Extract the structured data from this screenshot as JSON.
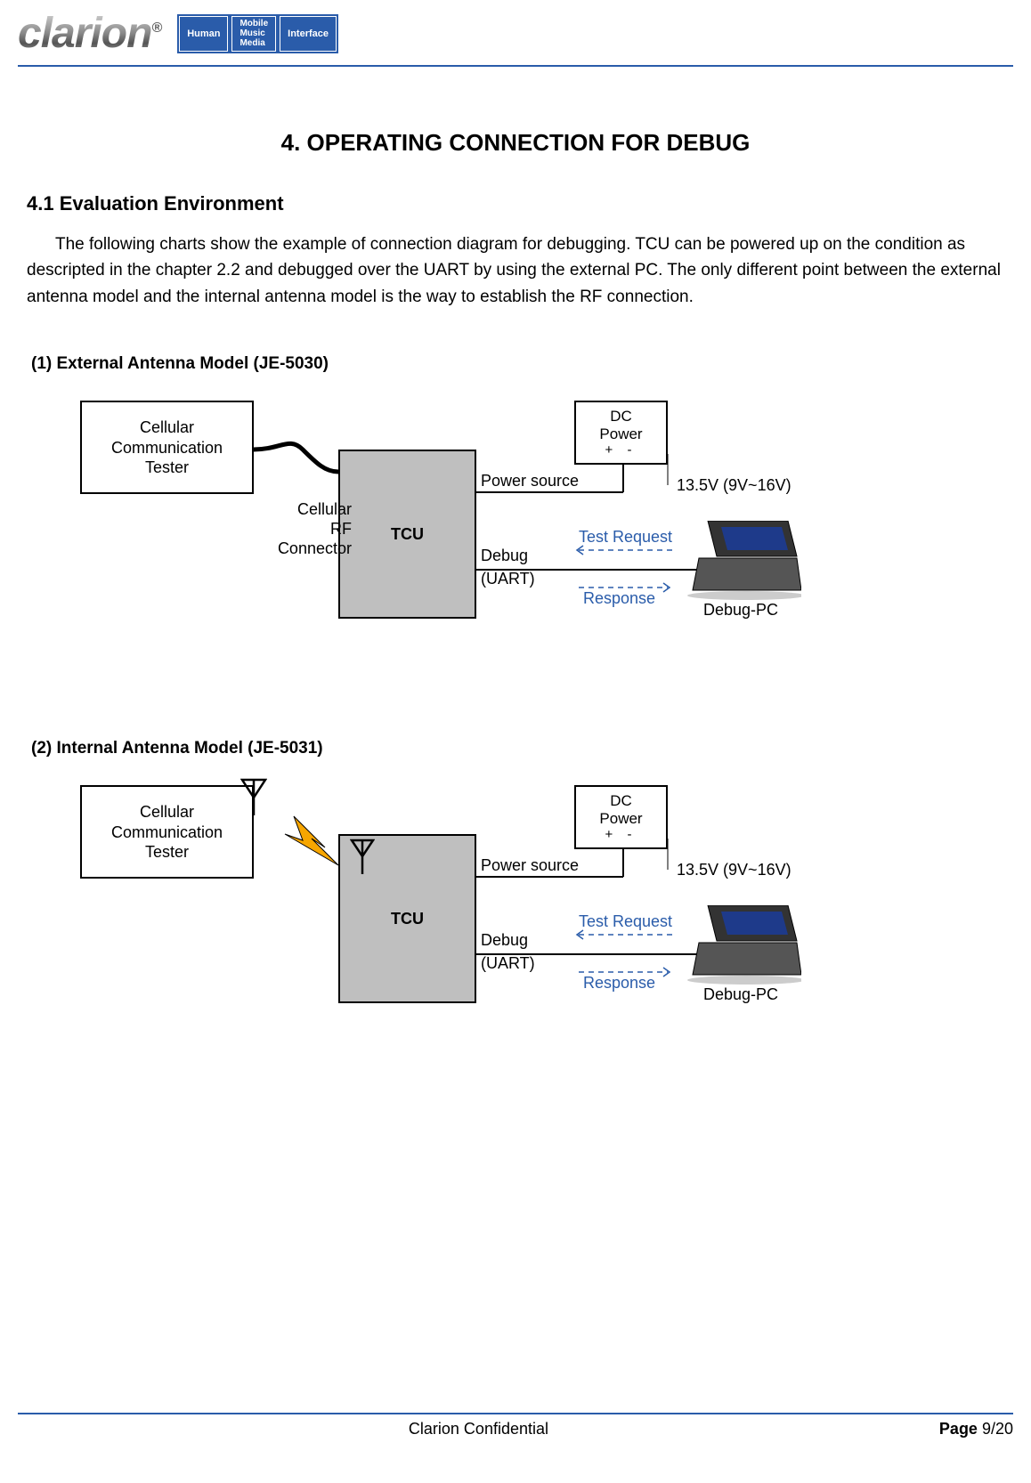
{
  "header": {
    "brand": "clarion",
    "badge_left": "Human",
    "badge_right_l1": "Mobile",
    "badge_right_l2": "Music",
    "badge_right_l3": "Media",
    "badge_right_l4": "Interface"
  },
  "title": "4.   OPERATING CONNECTION FOR DEBUG",
  "section_heading": "4.1 Evaluation Environment",
  "intro": "The following charts show the example of connection diagram for debugging.  TCU can be powered up on the condition as descripted in the chapter 2.2 and debugged over the UART by using the external PC. The only different point between the external antenna model and the internal antenna model is the way to establish the RF connection.",
  "diagrams": [
    {
      "heading": "(1) External Antenna Model (JE-5030)",
      "tester": "Cellular\nCommunication\nTester",
      "tcu": "TCU",
      "dc_l1": "DC",
      "dc_l2": "Power",
      "dc_terminals": "+   -",
      "rf_label": "Cellular\nRF Connector",
      "power_source": "Power source",
      "voltage": "13.5V (9V~16V)",
      "debug": "Debug",
      "uart": "(UART)",
      "test_request": "Test Request",
      "response": "Response",
      "debug_pc": "Debug-PC",
      "wireless": false
    },
    {
      "heading": "(2) Internal Antenna Model (JE-5031)",
      "tester": "Cellular\nCommunication\nTester",
      "tcu": "TCU",
      "dc_l1": "DC",
      "dc_l2": "Power",
      "dc_terminals": "+   -",
      "rf_label": "",
      "power_source": "Power source",
      "voltage": "13.5V (9V~16V)",
      "debug": "Debug",
      "uart": "(UART)",
      "test_request": "Test Request",
      "response": "Response",
      "debug_pc": "Debug-PC",
      "wireless": true
    }
  ],
  "footer": {
    "confidential": "Clarion Confidential",
    "page_label": "Page ",
    "page": "9/20"
  }
}
